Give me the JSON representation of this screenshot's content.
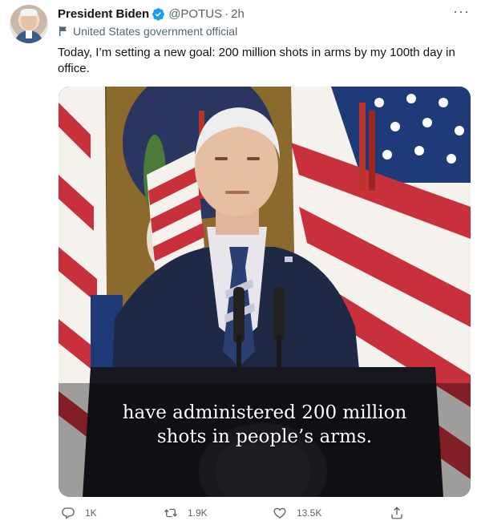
{
  "tweet": {
    "author_name": "President Biden",
    "handle": "@POTUS",
    "separator": "·",
    "time": "2h",
    "more_label": "···",
    "affiliation": "United States government official",
    "text": "Today, I’m setting a new goal: 200 million shots in arms by my 100th day in office.",
    "media": {
      "caption_line1": "have administered 200 million",
      "caption_line2": "shots in people’s arms."
    },
    "stats": {
      "replies": "1K",
      "retweets": "1.9K",
      "likes": "13.5K"
    }
  },
  "colors": {
    "verified_badge": "#1d9bf0",
    "muted_text": "#536471",
    "flag_red": "#c8313b",
    "flag_blue": "#1f3a78",
    "suit_navy": "#1e2a45"
  },
  "icons": {
    "verified": "verified-badge-icon",
    "affiliation": "flag-icon",
    "more": "more-icon",
    "reply": "reply-icon",
    "retweet": "retweet-icon",
    "like": "heart-icon",
    "share": "share-icon"
  }
}
